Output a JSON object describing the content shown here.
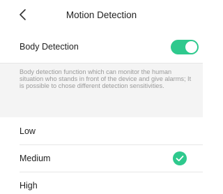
{
  "header": {
    "title": "Motion Detection",
    "back_icon": "chevron-left-icon"
  },
  "body_detection": {
    "label": "Body Detection",
    "enabled": true
  },
  "description": "Body detection function which can monitor the human situation who stands in front of the device and give alarms; It is possible to chose different detection sensitivities.",
  "sensitivity": {
    "options": [
      {
        "label": "Low",
        "selected": false
      },
      {
        "label": "Medium",
        "selected": true
      },
      {
        "label": "High",
        "selected": false
      }
    ]
  },
  "colors": {
    "accent": "#2ec98d",
    "muted_text": "#9a9a9a",
    "section_bg": "#f4f4f4"
  }
}
